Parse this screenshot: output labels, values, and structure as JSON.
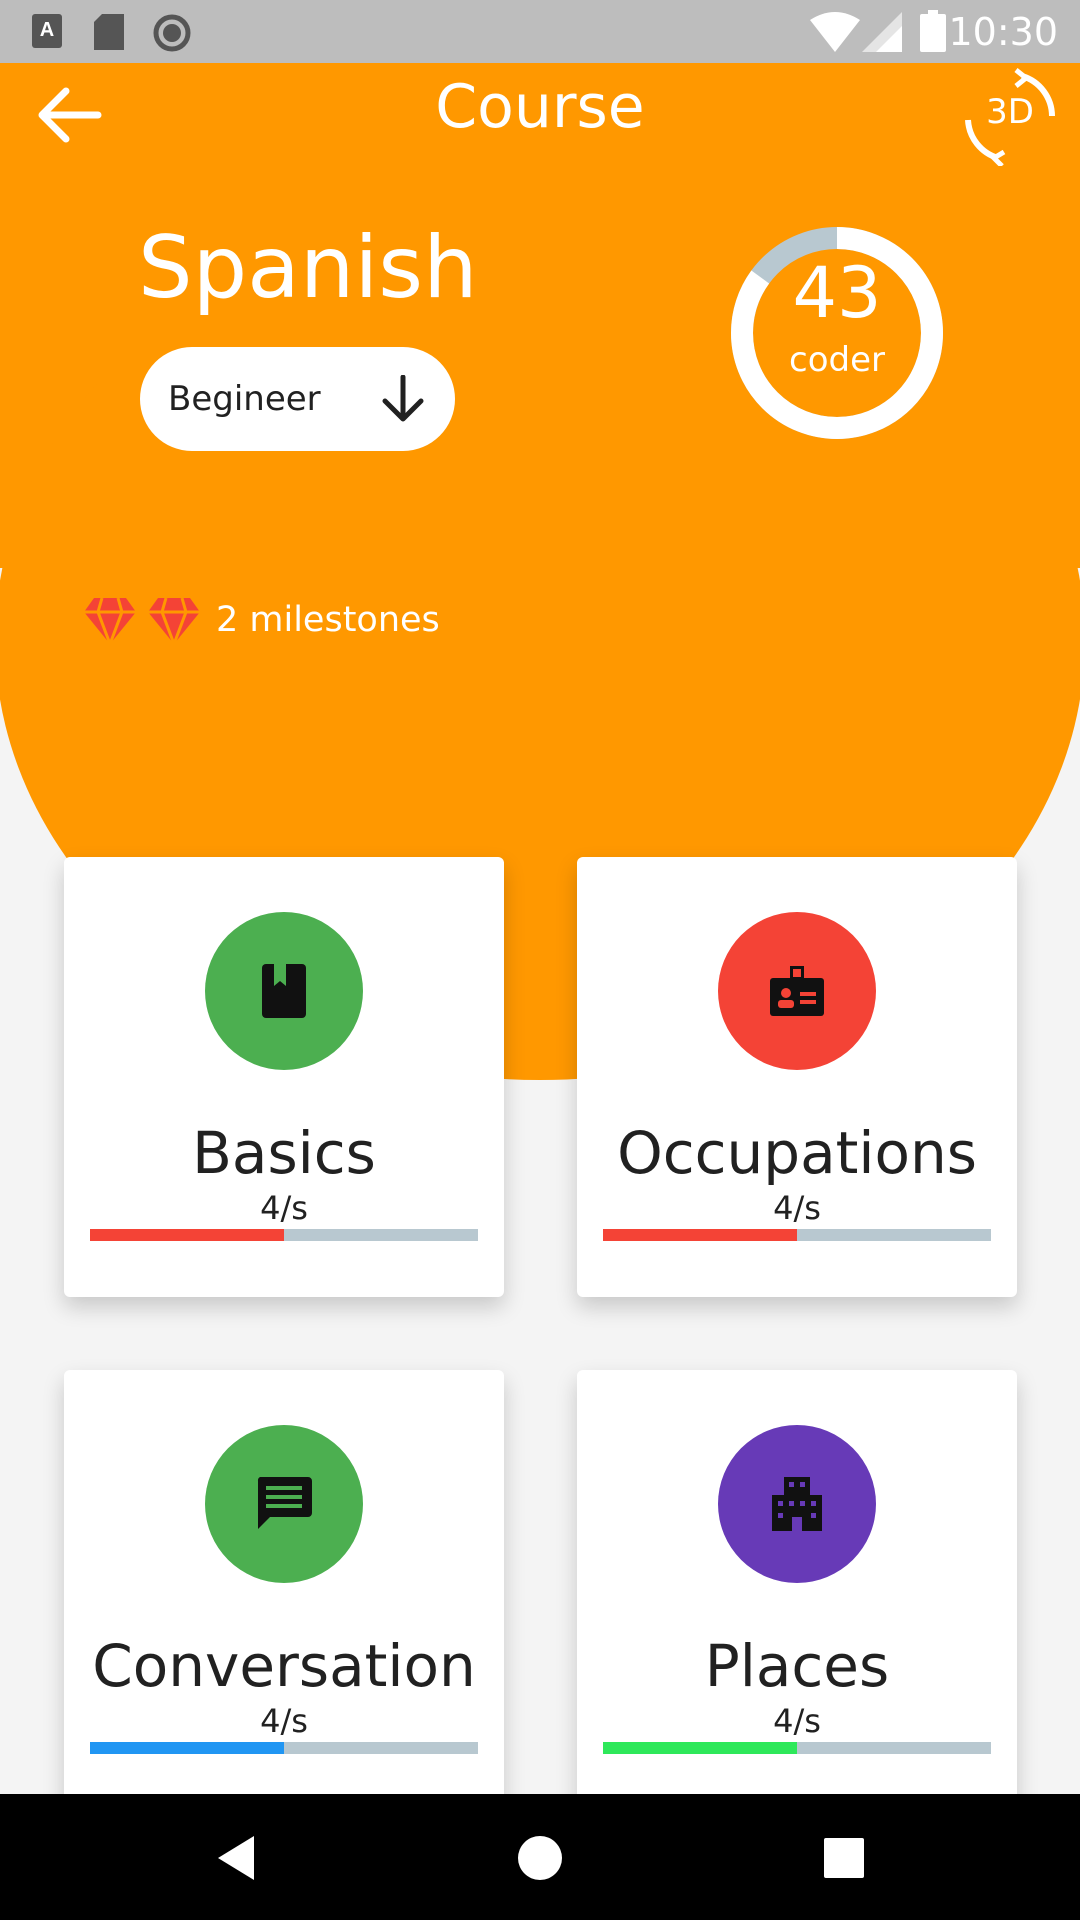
{
  "status_bar": {
    "time": "10:30",
    "icons": [
      "a-icon",
      "sd-card-icon",
      "circle-icon",
      "wifi-icon",
      "signal-icon",
      "battery-icon"
    ]
  },
  "header": {
    "title": "Course",
    "back_icon": "arrow-back-icon",
    "threed_label": "3D",
    "color": "#ff9800"
  },
  "course": {
    "language": "Spanish",
    "level": "Begineer",
    "score": "43",
    "score_caption": "coder",
    "score_progress": 0.85,
    "milestones_text": "2 milestones",
    "milestone_count": 2
  },
  "cards": [
    {
      "title": "Basics",
      "rate": "4/s",
      "icon": "book-icon",
      "icon_color": "#4caf50",
      "progress": 0.5,
      "bar_color": "#f44336"
    },
    {
      "title": "Occupations",
      "rate": "4/s",
      "icon": "badge-icon",
      "icon_color": "#f44336",
      "progress": 0.5,
      "bar_color": "#f44336"
    },
    {
      "title": "Conversation",
      "rate": "4/s",
      "icon": "chat-icon",
      "icon_color": "#4caf50",
      "progress": 0.5,
      "bar_color": "#2196f3"
    },
    {
      "title": "Places",
      "rate": "4/s",
      "icon": "building-icon",
      "icon_color": "#673ab7",
      "progress": 0.5,
      "bar_color": "#2ee85a"
    }
  ],
  "nav_bar": {
    "icons": [
      "back-triangle-icon",
      "home-circle-icon",
      "recents-square-icon"
    ]
  }
}
